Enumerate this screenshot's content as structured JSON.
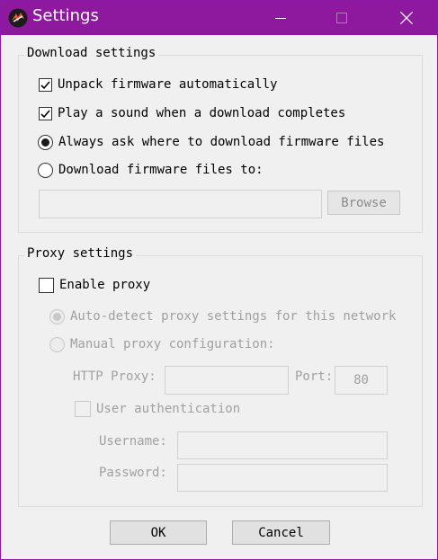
{
  "window": {
    "title": "Settings",
    "title_color": "#8e199f",
    "icons": {
      "app": "app-logo-icon",
      "minimize": "minimize-icon",
      "maximize": "maximize-icon",
      "close": "close-icon"
    }
  },
  "download_settings": {
    "title": "Download settings",
    "unpack_label": "Unpack firmware automatically",
    "unpack_checked": true,
    "sound_label": "Play a sound when a download completes",
    "sound_checked": true,
    "ask_label": "Always ask where to download firmware files",
    "ask_selected": true,
    "download_to_label": "Download firmware files to:",
    "download_to_selected": false,
    "path_value": "",
    "browse_label": "Browse"
  },
  "proxy_settings": {
    "title": "Proxy settings",
    "enable_label": "Enable proxy",
    "enable_checked": false,
    "auto_detect_label": "Auto-detect proxy settings for this network",
    "auto_detect_selected": true,
    "manual_label": "Manual proxy configuration:",
    "manual_selected": false,
    "http_proxy_label": "HTTP Proxy:",
    "http_proxy_value": "",
    "port_label": "Port:",
    "port_value": "80",
    "user_auth_label": "User authentication",
    "user_auth_checked": false,
    "username_label": "Username:",
    "username_value": "",
    "password_label": "Password:",
    "password_value": ""
  },
  "buttons": {
    "ok": "OK",
    "cancel": "Cancel"
  }
}
